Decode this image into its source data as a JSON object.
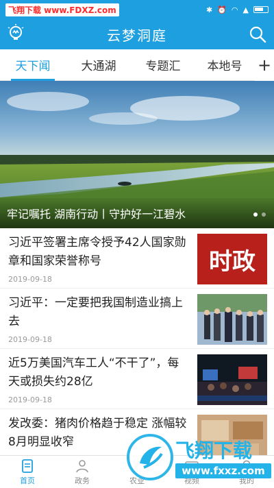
{
  "status_bar": {
    "watermark": "飞翔下载 www.FDXZ.com"
  },
  "app_bar": {
    "title": "云梦洞庭"
  },
  "tabs": [
    {
      "label": "天下闻",
      "active": true
    },
    {
      "label": "大通湖",
      "active": false
    },
    {
      "label": "专题汇",
      "active": false
    },
    {
      "label": "本地号",
      "active": false
    }
  ],
  "tab_add": "+",
  "banner": {
    "caption": "牢记嘱托 湖南行动丨守护好一江碧水"
  },
  "news": [
    {
      "title": "习近平签署主席令授予42人国家勋章和国家荣誉称号",
      "date": "2019-09-18",
      "thumb_text": "时政"
    },
    {
      "title": "习近平：一定要把我国制造业搞上去",
      "date": "2019-09-18"
    },
    {
      "title": "近5万美国汽车工人“不干了”，每天或损失约28亿",
      "date": "2019-09-18"
    },
    {
      "title": "发改委：猪肉价格趋于稳定 涨幅较8月明显收窄",
      "date": ""
    }
  ],
  "bottom_nav": [
    {
      "label": "首页",
      "icon": "home-icon",
      "active": true
    },
    {
      "label": "政务",
      "icon": "government-icon",
      "active": false
    },
    {
      "label": "农业",
      "icon": "agriculture-icon",
      "active": false
    },
    {
      "label": "视频",
      "icon": "video-icon",
      "active": false
    },
    {
      "label": "我的",
      "icon": "profile-icon",
      "active": false
    }
  ],
  "watermark": {
    "brand": "飞翔下载",
    "url": "www.fxxz.com"
  },
  "colors": {
    "primary": "#1e9fe0",
    "text": "#222222",
    "date": "#999999"
  }
}
